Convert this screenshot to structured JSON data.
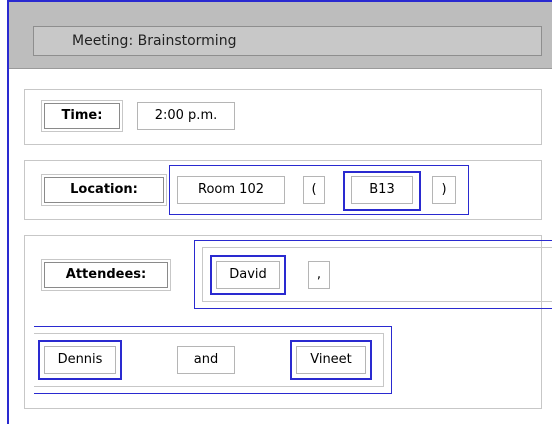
{
  "title": "Meeting: Brainstorming",
  "time": {
    "label": "Time:",
    "value": "2:00 p.m."
  },
  "location": {
    "label": "Location:",
    "room": "Room 102",
    "open_paren": "(",
    "code": "B13",
    "close_paren": ")"
  },
  "attendees": {
    "label": "Attendees:",
    "names": [
      "David",
      "Dennis",
      "Vineet"
    ],
    "comma": ",",
    "and": "and"
  },
  "colors": {
    "selection": "#2a2ad0",
    "titlebar": "#bdbdbd"
  }
}
